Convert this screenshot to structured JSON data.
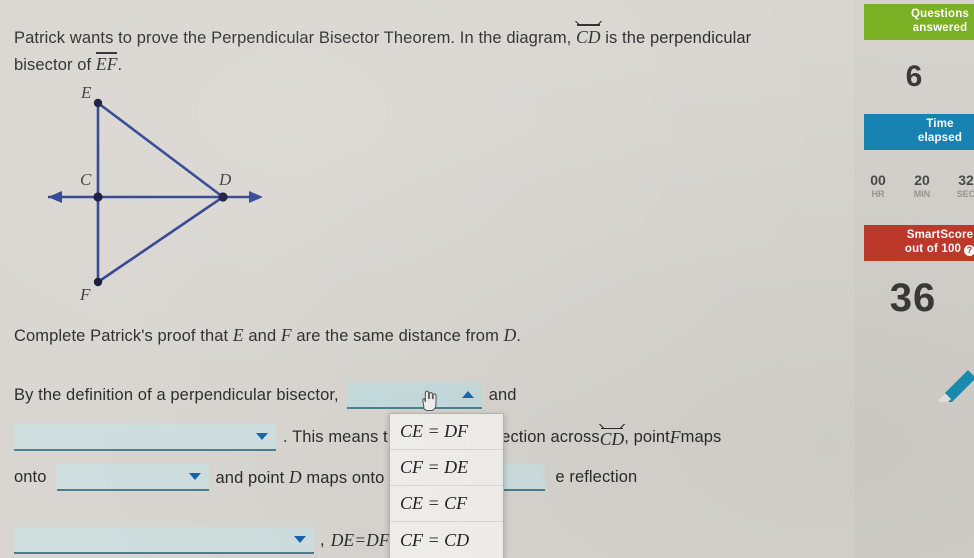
{
  "question": {
    "stem_part1": "Patrick wants to prove the Perpendicular Bisector Theorem. In the diagram, ",
    "stem_cd": "CD",
    "stem_part2": " is the perpendicular bisector of ",
    "stem_ef": "EF",
    "stem_part3": "."
  },
  "diagram": {
    "labels": {
      "E": "E",
      "C": "C",
      "D": "D",
      "F": "F"
    },
    "line_color": "#2d3f8f",
    "point_color": "#1a1a3d"
  },
  "proof": {
    "prompt_part1": "Complete Patrick's proof that ",
    "prompt_e": "E",
    "prompt_and": " and ",
    "prompt_f": "F",
    "prompt_part2": " are the same distance from ",
    "prompt_d": "D",
    "prompt_end": ".",
    "line1_prefix": "By the definition of a perpendicular bisector,",
    "line1_suffix": "and",
    "line2_prefix": "",
    "line2_text": ". This means t",
    "line2_reflection": "flection across ",
    "line2_cd": "CD",
    "line2_after": ", point ",
    "line2_f": "F",
    "line2_maps": " maps",
    "line3_onto": "onto",
    "line3_mid": "and point ",
    "line3_d": "D",
    "line3_maps": " maps onto",
    "line3_tail": "e reflection",
    "line4_comma": ",",
    "line4_eq_de": "DE",
    "line4_eq": " = ",
    "line4_eq_df": "DF"
  },
  "dropdown": {
    "expanded": true,
    "options": [
      "CE = DF",
      "CF = DE",
      "CE = CF",
      "CF = CD"
    ]
  },
  "sidebar": {
    "questions_badge_line1": "Questions",
    "questions_badge_line2": "answered",
    "questions_value": "6",
    "time_badge_line1": "Time",
    "time_badge_line2": "elapsed",
    "timer": [
      {
        "num": "00",
        "unit": "HR"
      },
      {
        "num": "20",
        "unit": "MIN"
      },
      {
        "num": "32",
        "unit": "SEC"
      }
    ],
    "score_badge_line1": "SmartScore",
    "score_badge_line2": "out of 100",
    "score_info": "?",
    "score_value": "36",
    "colors": {
      "questions": "#7ab023",
      "time": "#1884b4",
      "score": "#c0392b"
    }
  }
}
